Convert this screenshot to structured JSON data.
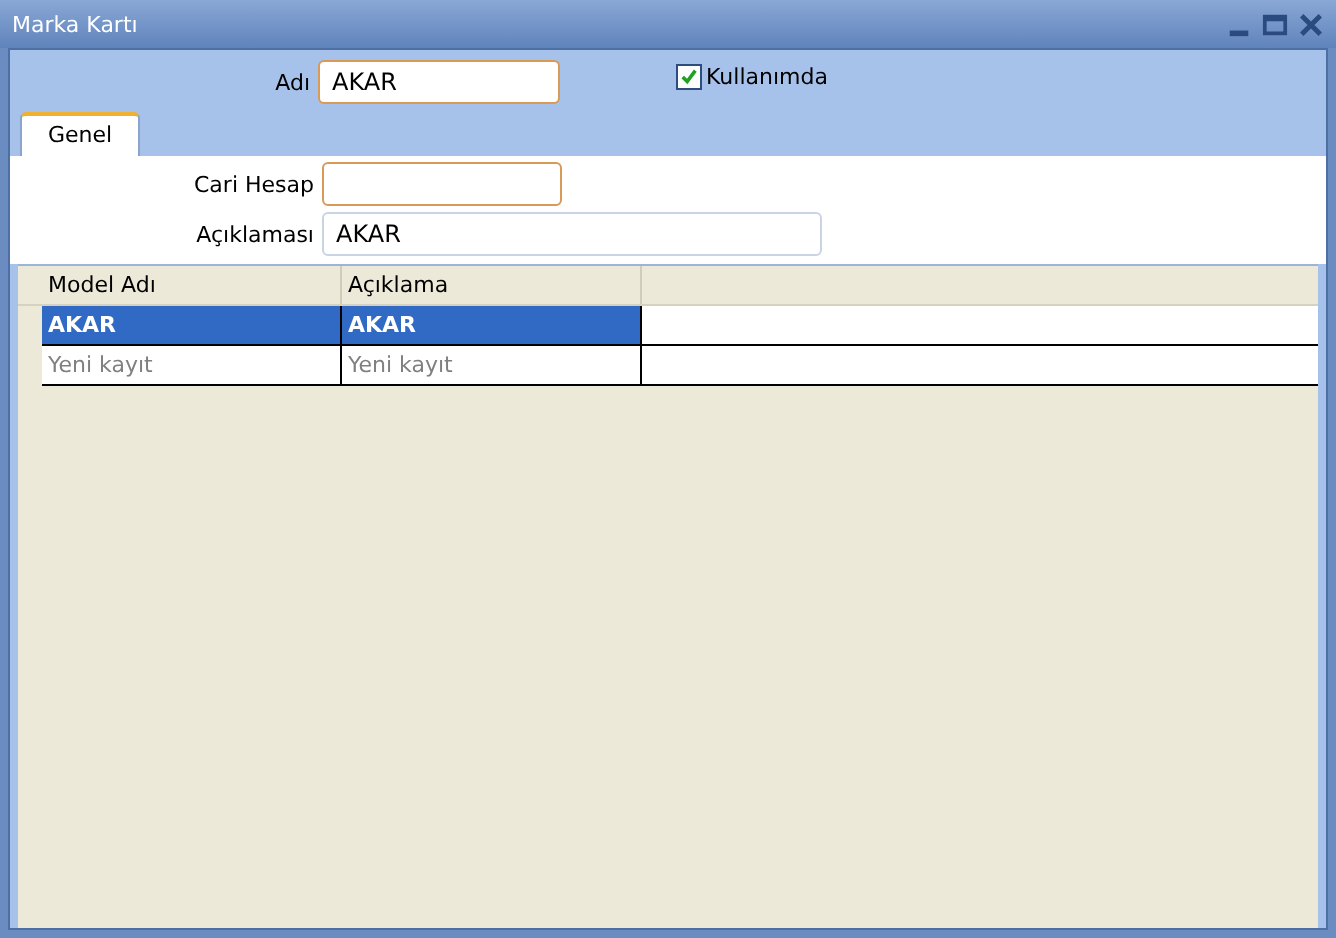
{
  "window": {
    "title": "Marka Kartı"
  },
  "name_field": {
    "label": "Adı",
    "value": "AKAR"
  },
  "in_use": {
    "label": "Kullanımda",
    "checked": true
  },
  "tabs": [
    {
      "label": "Genel",
      "selected": true
    }
  ],
  "fields": [
    {
      "label": "Cari Hesap",
      "focused": true
    },
    {
      "label": "Açıklaması",
      "value": "AKAR",
      "focused": false
    }
  ],
  "table": {
    "columns": [
      "Model Adı",
      "Açıklama"
    ],
    "rows": [
      {
        "cells": [
          "AKAR",
          "AKAR"
        ],
        "selected": true,
        "kind": "record"
      },
      {
        "cells": [
          "Yeni kayıt",
          "Yeni kayıt"
        ],
        "selected": false,
        "kind": "new"
      }
    ]
  }
}
